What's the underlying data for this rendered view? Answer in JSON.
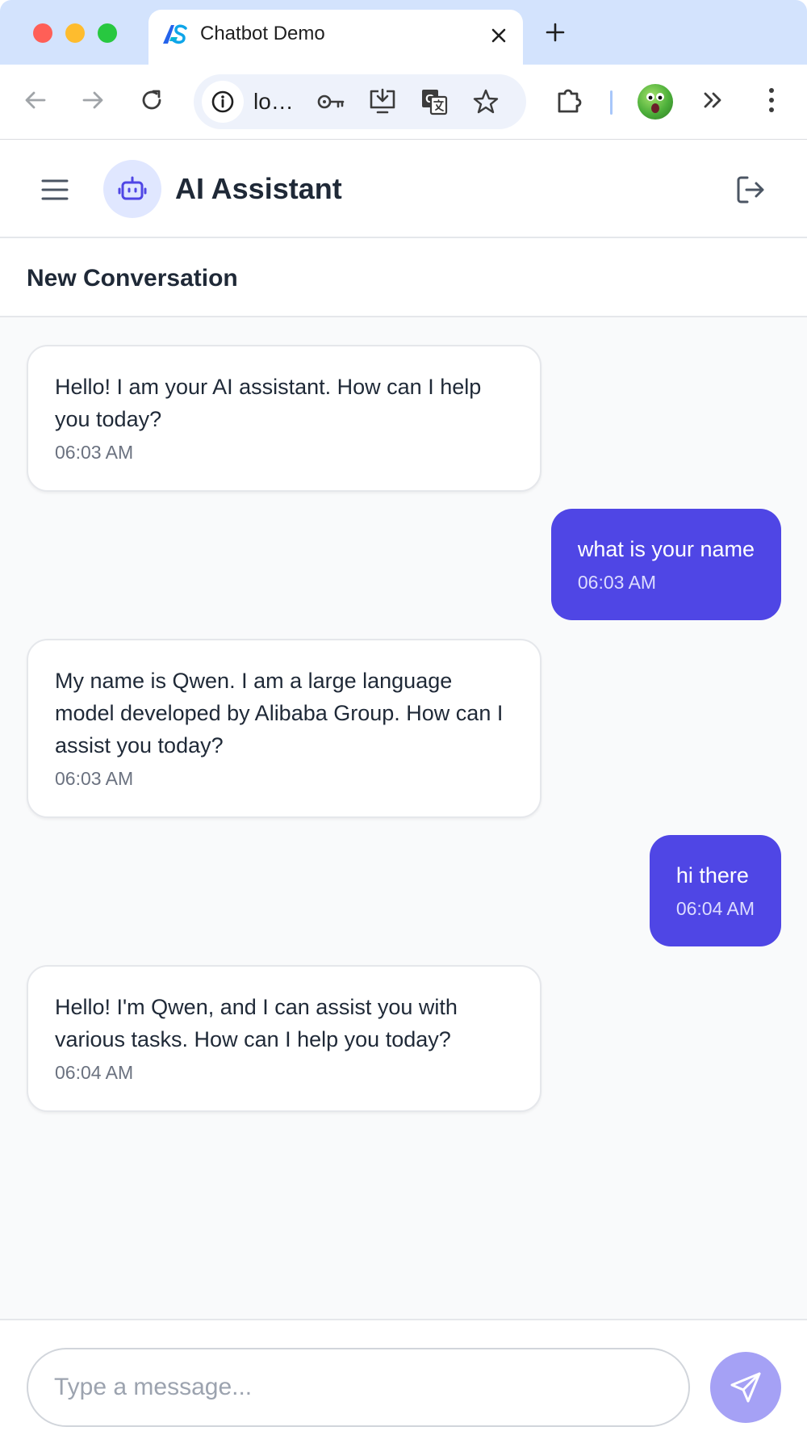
{
  "browser": {
    "tab_title": "Chatbot Demo",
    "url_display": "lo…"
  },
  "app": {
    "title": "AI Assistant",
    "conversation_title": "New Conversation"
  },
  "messages": [
    {
      "role": "assistant",
      "text": "Hello! I am your AI assistant. How can I help you today?",
      "time": "06:03 AM"
    },
    {
      "role": "user",
      "text": "what is your name",
      "time": "06:03 AM"
    },
    {
      "role": "assistant",
      "text": "My name is Qwen. I am a large language model developed by Alibaba Group. How can I assist you today?",
      "time": "06:03 AM"
    },
    {
      "role": "user",
      "text": "hi there",
      "time": "06:04 AM"
    },
    {
      "role": "assistant",
      "text": "Hello! I'm Qwen, and I can assist you with various tasks. How can I help you today?",
      "time": "06:04 AM"
    }
  ],
  "composer": {
    "placeholder": "Type a message..."
  },
  "colors": {
    "accent": "#4f46e5",
    "send_button": "#a5a1f5",
    "bot_avatar_bg": "#e0e7ff"
  },
  "icons": {
    "menu": "hamburger-menu-icon",
    "bot": "robot-icon",
    "logout": "logout-icon",
    "send": "paper-plane-icon"
  }
}
